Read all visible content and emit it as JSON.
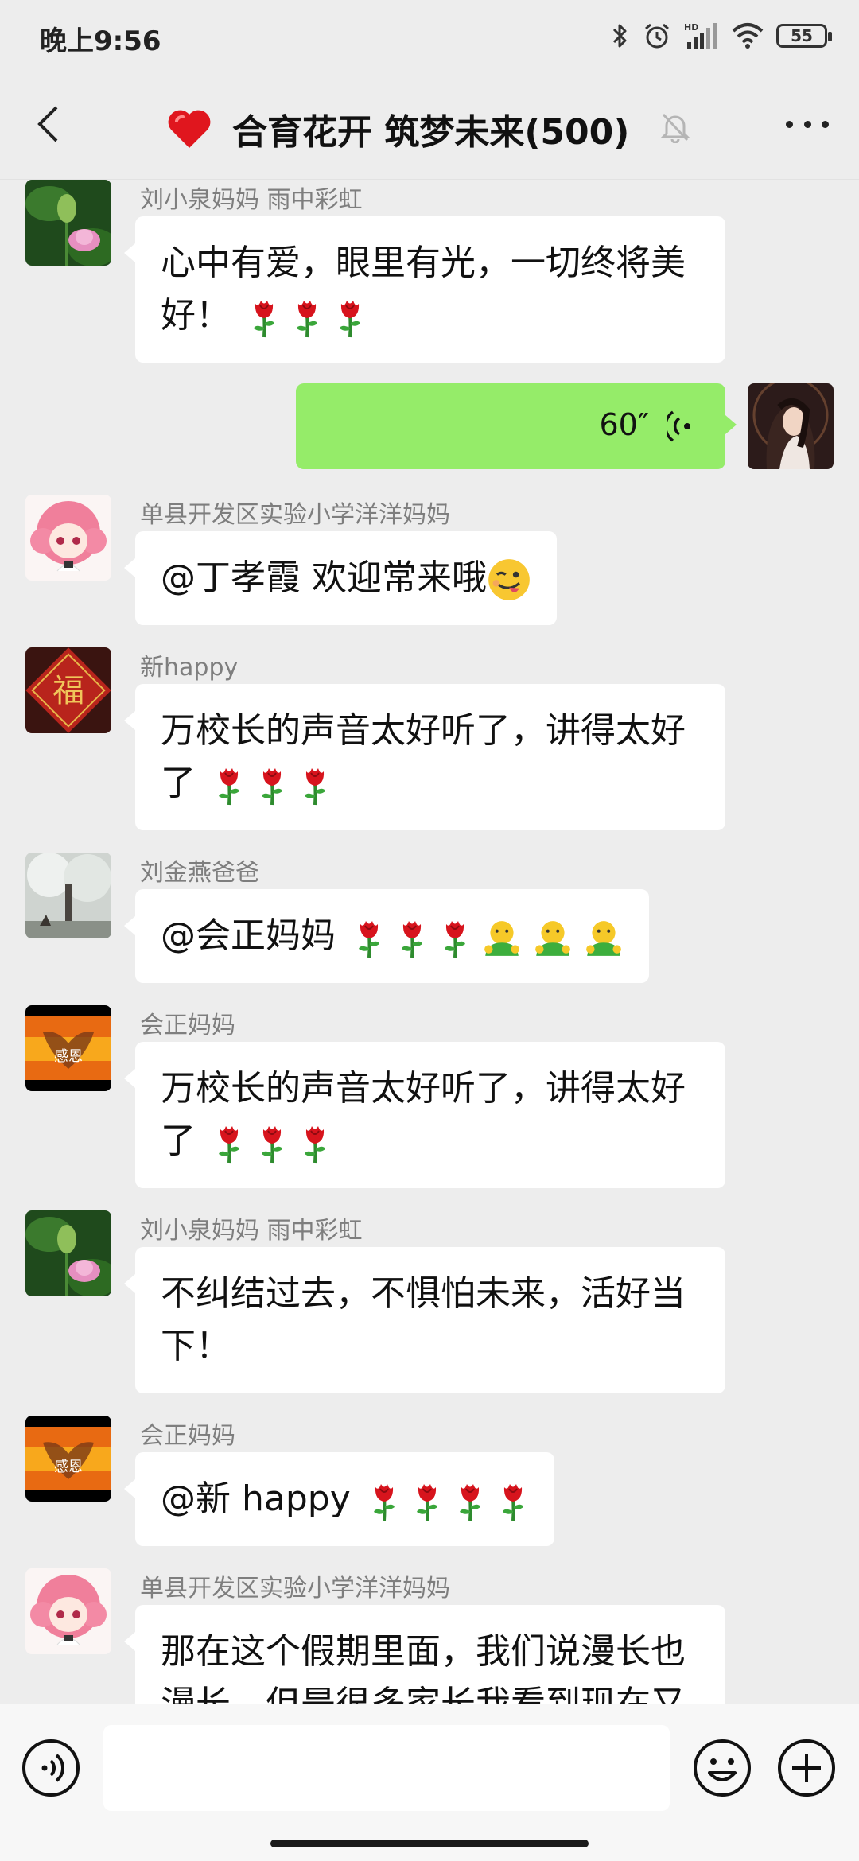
{
  "status_bar": {
    "time": "晚上9:56",
    "battery": "55",
    "network_label": "HD"
  },
  "header": {
    "title": "合育花开 筑梦未来(500)",
    "title_emoji": "heart-icon"
  },
  "messages": [
    {
      "type": "text",
      "sender": "刘小泉妈妈  雨中彩虹",
      "text": "心中有爱，眼里有光，一切终将美好！",
      "emoji": [
        "rose",
        "rose",
        "rose"
      ]
    },
    {
      "type": "voice",
      "sender": "me",
      "duration": "60″"
    },
    {
      "type": "text",
      "sender": "单县开发区实验小学洋洋妈妈",
      "text": "@丁孝霞  欢迎常来哦",
      "emoji": [
        "wink"
      ]
    },
    {
      "type": "text",
      "sender": "新happy",
      "text": "万校长的声音太好听了，讲得太好了",
      "emoji": [
        "rose",
        "rose",
        "rose"
      ]
    },
    {
      "type": "text",
      "sender": "刘金燕爸爸",
      "text": "@会正妈妈 ",
      "emoji": [
        "rose",
        "rose",
        "rose",
        "hug",
        "hug",
        "hug"
      ]
    },
    {
      "type": "text",
      "sender": "会正妈妈",
      "text": "万校长的声音太好听了，讲得太好了",
      "emoji": [
        "rose",
        "rose",
        "rose"
      ]
    },
    {
      "type": "text",
      "sender": "刘小泉妈妈  雨中彩虹",
      "text": "不纠结过去，不惧怕未来，活好当下！",
      "emoji": []
    },
    {
      "type": "text",
      "sender": "会正妈妈",
      "text": "@新 happy ",
      "emoji": [
        "rose",
        "rose",
        "rose",
        "rose"
      ]
    },
    {
      "type": "text",
      "sender": "单县开发区实验小学洋洋妈妈",
      "text": "那在这个假期里面，我们说漫长也漫长，但是很多家长我看到现在又",
      "emoji": []
    }
  ],
  "avatar_labels": {
    "fu": "福",
    "ganen": "感恩"
  },
  "input": {
    "value": "",
    "placeholder": ""
  },
  "colors": {
    "background": "#ededed",
    "my_bubble": "#95ec69",
    "other_bubble": "#ffffff",
    "sender_name": "#7e7e7e"
  }
}
